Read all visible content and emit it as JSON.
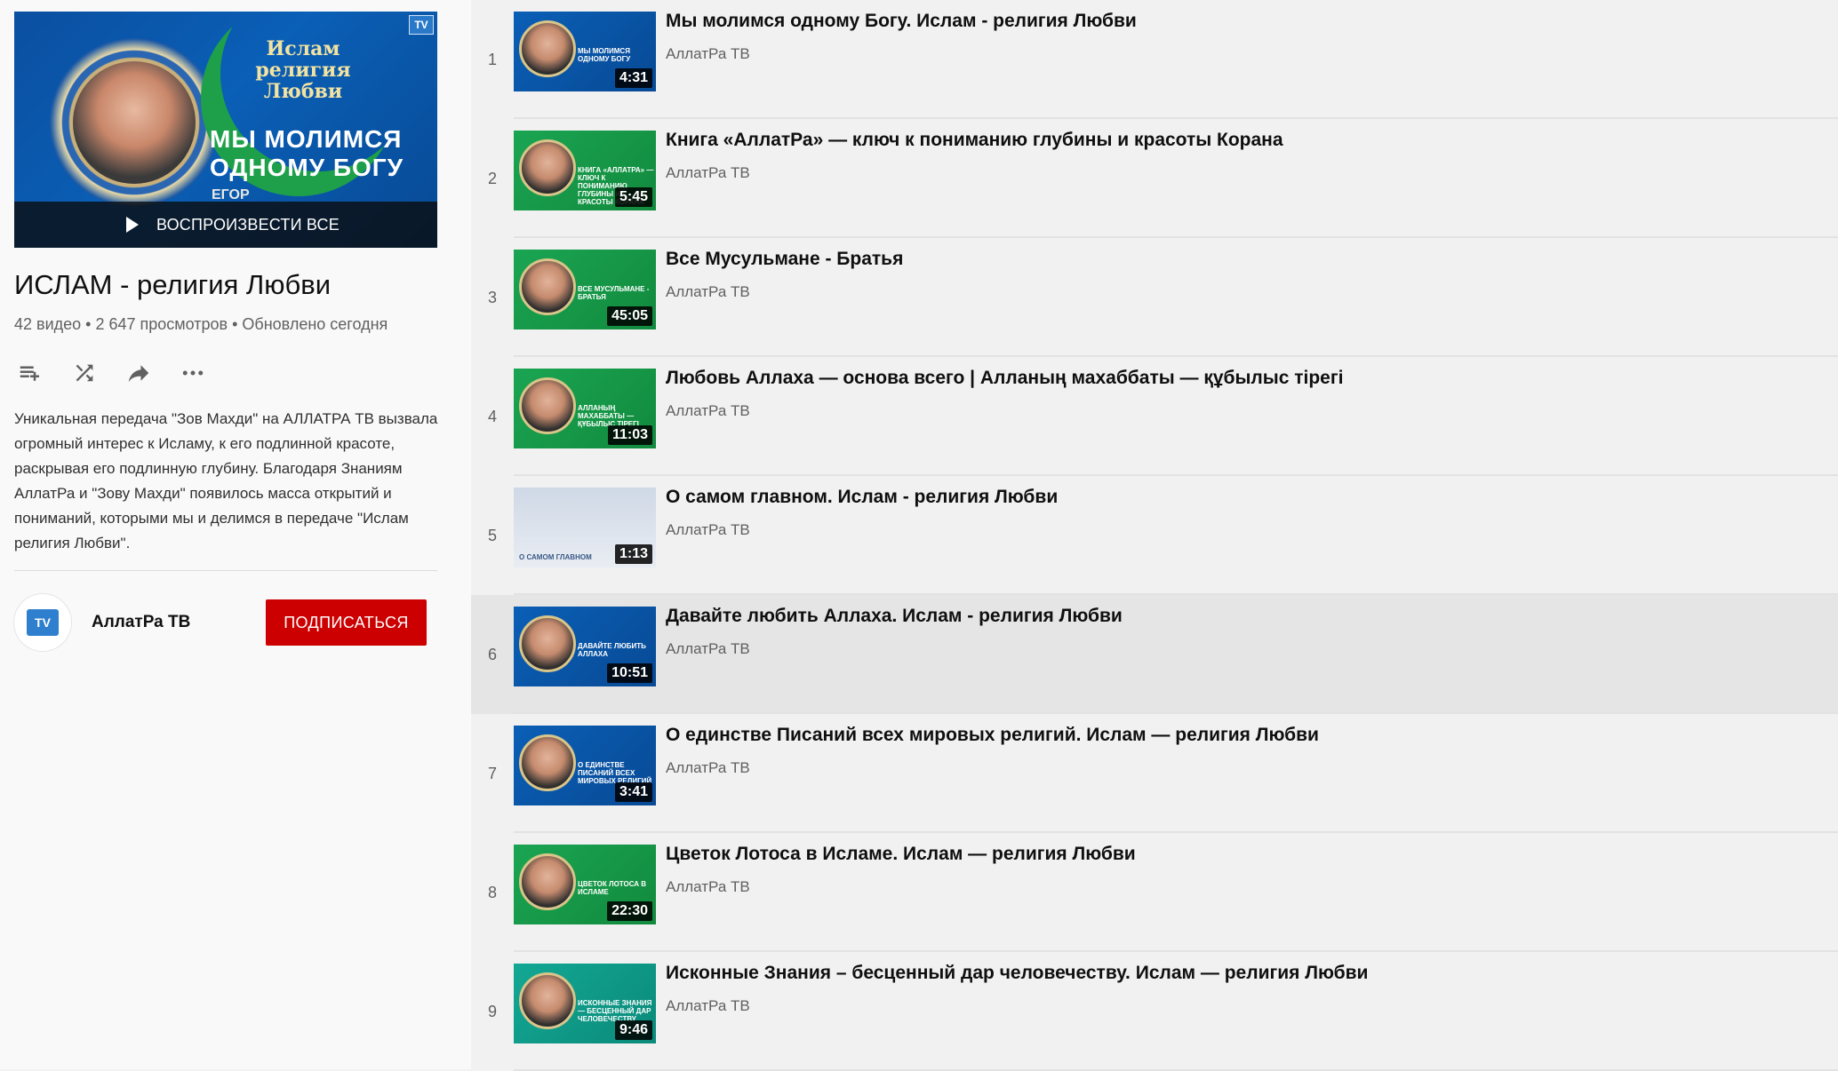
{
  "sidebar": {
    "hero": {
      "brand_line1": "Ислам",
      "brand_line2": "религия",
      "brand_line3": "Любви",
      "title_line1": "МЫ МОЛИМСЯ",
      "title_line2": "ОДНОМУ БОГУ",
      "subtitle": "ЕГОР",
      "logo": "TV",
      "play_all_label": "ВОСПРОИЗВЕСТИ ВСЕ"
    },
    "playlist_title": "ИСЛАМ - религия Любви",
    "stats": "42 видео • 2 647 просмотров • Обновлено сегодня",
    "actions": [
      {
        "icon": "add-to-queue-icon"
      },
      {
        "icon": "shuffle-icon"
      },
      {
        "icon": "share-icon"
      },
      {
        "icon": "more-icon"
      }
    ],
    "description": "Уникальная передача \"Зов Махди\" на АЛЛАТРА ТВ вызвала огромный интерес к Исламу, к его подлинной красоте, раскрывая его подлинную глубину. Благодаря Знаниям АллатРа и \"Зову Махди\" появилось масса открытий и пониманий, которыми мы и делимся в передаче \"Ислам религия Любви\".",
    "owner": {
      "name": "АллатРа ТВ",
      "avatar_text": "TV",
      "subscribe_label": "ПОДПИСАТЬСЯ"
    }
  },
  "colors": {
    "subscribe": "#cc0000",
    "active_row": "#e5e5e5",
    "blue_thumb": "#0a5fb6",
    "green_thumb": "#169a48",
    "teal_thumb": "#0f9f8c"
  },
  "videos": [
    {
      "index": "1",
      "title": "Мы молимся одному Богу. Ислам - религия Любви",
      "channel": "АллатРа ТВ",
      "duration": "4:31",
      "thumb_text": "МЫ МОЛИМСЯ ОДНОМУ БОГУ",
      "bg": "blue",
      "active": false
    },
    {
      "index": "2",
      "title": "Книга «АллатРа» — ключ к пониманию глубины и красоты Корана",
      "channel": "АллатРа ТВ",
      "duration": "5:45",
      "thumb_text": "КНИГА «АЛЛАТРА» — КЛЮЧ К ПОНИМАНИЮ ГЛУБИНЫ И КРАСОТЫ КОРАНА",
      "bg": "green",
      "active": false
    },
    {
      "index": "3",
      "title": "Все Мусульмане - Братья",
      "channel": "АллатРа ТВ",
      "duration": "45:05",
      "thumb_text": "ВСЕ МУСУЛЬМАНЕ - БРАТЬЯ",
      "bg": "green",
      "active": false
    },
    {
      "index": "4",
      "title": "Любовь Аллаха — основа всего | Алланың махаббаты — құбылыс тірегі",
      "channel": "АллатРа ТВ",
      "duration": "11:03",
      "thumb_text": "АЛЛАНЫҢ МАХАББАТЫ — ҚҰБЫЛЫС ТІРЕГІ",
      "bg": "green",
      "active": false
    },
    {
      "index": "5",
      "title": "О самом главном. Ислам - религия Любви",
      "channel": "АллатРа ТВ",
      "duration": "1:13",
      "thumb_text": "О САМОМ ГЛАВНОМ",
      "bg": "studio",
      "active": false
    },
    {
      "index": "6",
      "title": "Давайте любить Аллаха. Ислам - религия Любви",
      "channel": "АллатРа ТВ",
      "duration": "10:51",
      "thumb_text": "ДАВАЙТЕ ЛЮБИТЬ АЛЛАХА",
      "bg": "blue",
      "active": true
    },
    {
      "index": "7",
      "title": "О единстве Писаний всех мировых религий. Ислам — религия Любви",
      "channel": "АллатРа ТВ",
      "duration": "3:41",
      "thumb_text": "О ЕДИНСТВЕ ПИСАНИЙ ВСЕХ МИРОВЫХ РЕЛИГИЙ",
      "bg": "blue",
      "active": false
    },
    {
      "index": "8",
      "title": "Цветок Лотоса в Исламе. Ислам — религия Любви",
      "channel": "АллатРа ТВ",
      "duration": "22:30",
      "thumb_text": "ЦВЕТОК ЛОТОСА В ИСЛАМЕ",
      "bg": "green",
      "active": false
    },
    {
      "index": "9",
      "title": "Исконные Знания – бесценный дар человечеству. Ислам — религия Любви",
      "channel": "АллатРа ТВ",
      "duration": "9:46",
      "thumb_text": "ИСКОННЫЕ ЗНАНИЯ — БЕСЦЕННЫЙ ДАР ЧЕЛОВЕЧЕСТВУ",
      "bg": "teal",
      "active": false
    }
  ]
}
